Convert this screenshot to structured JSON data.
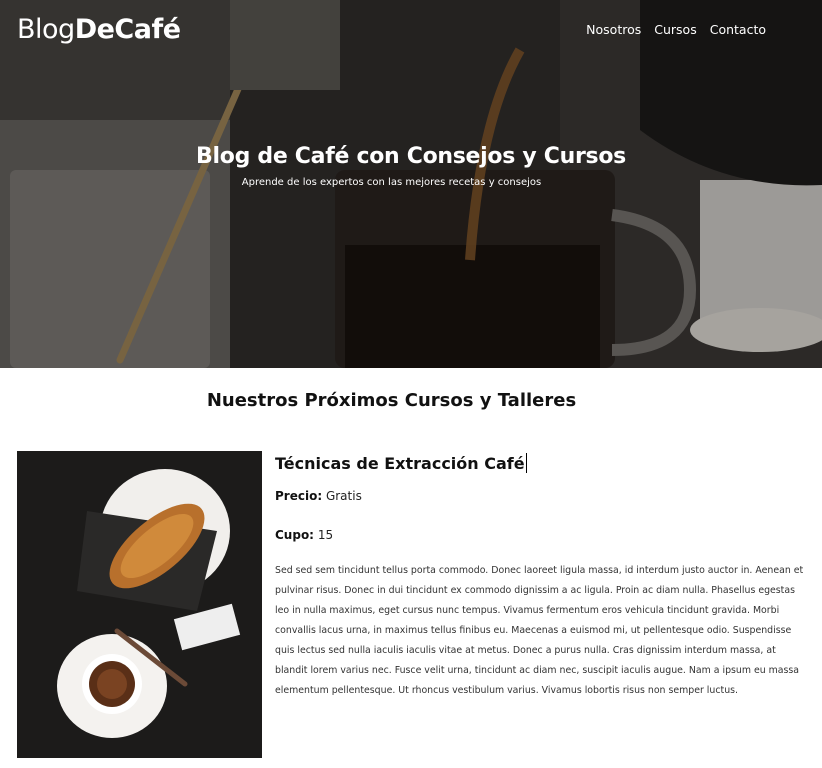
{
  "brand": {
    "light": "Blog",
    "bold": "DeCafé"
  },
  "nav": {
    "items": [
      "Nosotros",
      "Cursos",
      "Contacto"
    ]
  },
  "hero": {
    "title": "Blog de Café con Consejos y Cursos",
    "subtitle": "Aprende de los expertos con las mejores recetas y consejos"
  },
  "section": {
    "title": "Nuestros Próximos Cursos y Talleres"
  },
  "course": {
    "title": "Técnicas de Extracción Café",
    "price_label": "Precio:",
    "price_value": "Gratis",
    "cupo_label": "Cupo:",
    "cupo_value": "15",
    "description": "Sed sed sem tincidunt tellus porta commodo. Donec laoreet ligula massa, id interdum justo auctor in. Aenean et pulvinar risus. Donec in dui tincidunt ex commodo dignissim a ac ligula. Proin ac diam nulla. Phasellus egestas leo in nulla maximus, eget cursus nunc tempus. Vivamus fermentum eros vehicula tincidunt gravida. Morbi convallis lacus urna, in maximus tellus finibus eu. Maecenas a euismod mi, ut pellentesque odio. Suspendisse quis lectus sed nulla iaculis iaculis vitae at metus. Donec a purus nulla. Cras dignissim interdum massa, at blandit lorem varius nec. Fusce velit urna, tincidunt ac diam nec, suscipit iaculis augue. Nam a ipsum eu massa elementum pellentesque. Ut rhoncus vestibulum varius. Vivamus lobortis risus non semper luctus."
  }
}
